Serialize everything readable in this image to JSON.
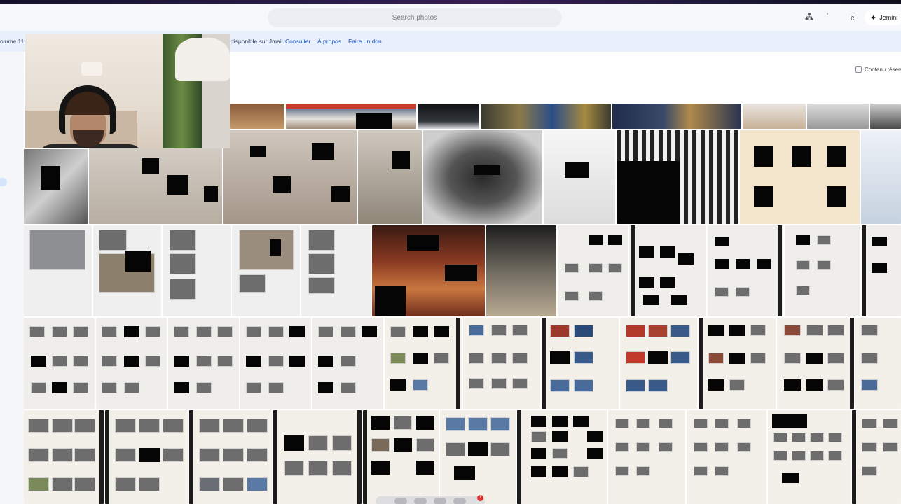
{
  "app": {
    "search": {
      "placeholder": "Search photos"
    },
    "toolbar": {
      "icon_sitemap": "sitemap-icon",
      "icon_tick": "dot-icon",
      "icon_c": "ċ",
      "gemini_label": "Jemini"
    },
    "banner": {
      "volume_text": "olume 11",
      "notice_text": "disponible sur Jmail.",
      "links": [
        "Consulter",
        "À propos",
        "Faire un don"
      ]
    },
    "filter": {
      "label": "Contenu réserv"
    },
    "dock": {
      "badge": "1"
    }
  },
  "colors": {
    "accent_link": "#1a56c8",
    "banner_bg": "#eaf0fb",
    "redaction": "#050505"
  }
}
